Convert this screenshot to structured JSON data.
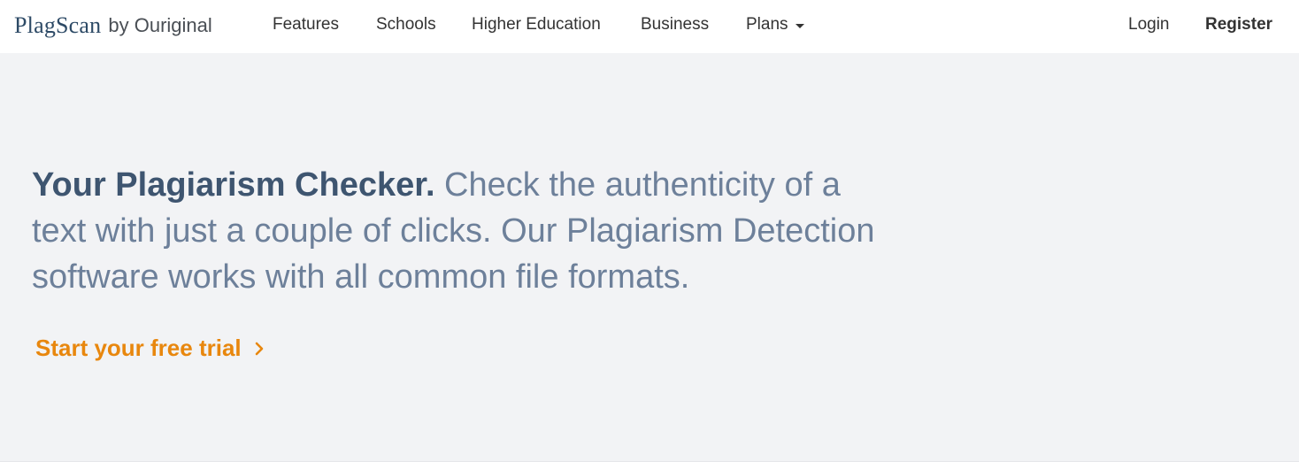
{
  "brand": {
    "name": "PlagScan",
    "by": "by Ouriginal"
  },
  "nav": {
    "items": [
      {
        "label": "Features"
      },
      {
        "label": "Schools"
      },
      {
        "label": "Higher Education"
      },
      {
        "label": "Business"
      },
      {
        "label": "Plans"
      }
    ],
    "login": "Login",
    "register": "Register"
  },
  "hero": {
    "headline_bold": "Your Plagiarism Checker.",
    "headline_rest": " Check the authenticity of a text with just a couple of clicks. Our Plagiarism Detection software works with all common file formats.",
    "cta_label": "Start your free trial"
  },
  "icons": {
    "plans_caret": "caret-down-icon",
    "cta_chevron": "chevron-right-icon"
  },
  "colors": {
    "brand": "#2d4a66",
    "hero_background": "#f2f3f5",
    "headline_bold": "#3e5570",
    "headline_text": "#6d809a",
    "cta": "#e8870e"
  }
}
